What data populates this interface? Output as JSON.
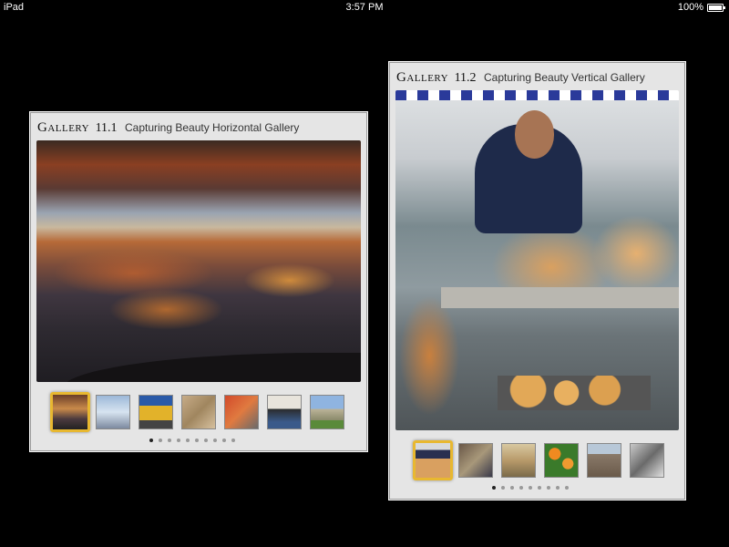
{
  "status_bar": {
    "device": "iPad",
    "time": "3:57 PM",
    "battery": "100%"
  },
  "galleries": [
    {
      "label": "Gallery",
      "number": "11.1",
      "caption": "Capturing Beauty Horizontal Gallery",
      "thumb_count": 7,
      "selected_thumb": 1,
      "page_count": 10,
      "current_page": 1
    },
    {
      "label": "Gallery",
      "number": "11.2",
      "caption": "Capturing Beauty Vertical Gallery",
      "thumb_count": 6,
      "selected_thumb": 1,
      "page_count": 9,
      "current_page": 1
    }
  ],
  "colors": {
    "background": "#000000",
    "panel": "#e5e5e5",
    "selected_thumb_border": "#e8b830"
  }
}
